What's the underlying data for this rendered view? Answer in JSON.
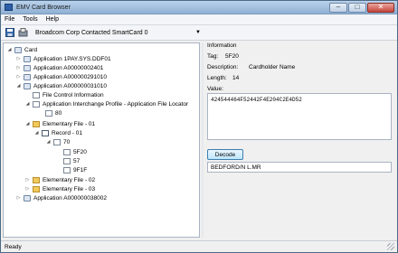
{
  "window": {
    "title": "EMV Card Browser"
  },
  "menu": {
    "items": [
      "File",
      "Tools",
      "Help"
    ]
  },
  "toolbar": {
    "reader": "Broadcom Corp Contacted SmartCard 0"
  },
  "tree": {
    "card": "Card",
    "app1": "Application 1PAY.SYS.DDF01",
    "app2": "Application A00000002401",
    "app3": "Application A000000291010",
    "app4": "Application A000000031010",
    "fci": "File Control Information",
    "aip": "Application Interchange Profile - Application File Locator",
    "aip_child": "80",
    "ef1": "Elementary File - 01",
    "rec1": "Record - 01",
    "tag70": "70",
    "tag5f20": "5F20",
    "tag57": "57",
    "tag9f1f": "9F1F",
    "ef2": "Elementary File - 02",
    "ef3": "Elementary File - 03",
    "app5": "Application A000000038002"
  },
  "info": {
    "heading": "Information",
    "tag_label": "Tag:",
    "tag_value": "5F20",
    "desc_label": "Description:",
    "desc_value": "Cardholder Name",
    "length_label": "Length:",
    "length_value": "14",
    "value_label": "Value:",
    "value_hex": "424544464F52442F4E204C2E4D52",
    "decode_label": "Decode",
    "decoded_text": "BEDFORD/N L.MR"
  },
  "status": {
    "text": "Ready"
  }
}
